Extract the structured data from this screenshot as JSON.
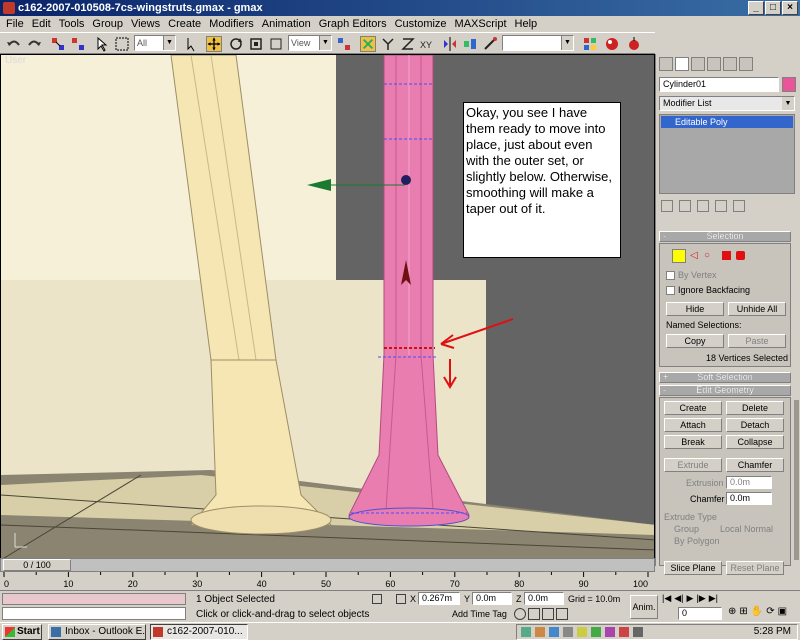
{
  "window": {
    "title": "c162-2007-010508-7cs-wingstruts.gmax - gmax"
  },
  "menu": [
    "File",
    "Edit",
    "Tools",
    "Group",
    "Views",
    "Create",
    "Modifiers",
    "Animation",
    "Graph Editors",
    "Customize",
    "MAXScript",
    "Help"
  ],
  "toolbar": {
    "selection_filter": "All",
    "reference_coord": "View",
    "named_selection": ""
  },
  "viewport": {
    "label": "User",
    "note": "Okay, you see I have them ready to move into place, just about even with the outer set, or slightly below. Otherwise, smoothing will make a taper out of it.",
    "colors": {
      "strut": "#f5e6b4",
      "pink_cylinder": "#e97db0",
      "background": "#646464",
      "arrow": "#e01010"
    }
  },
  "command_panel": {
    "object_name": "Cylinder01",
    "object_color": "#e8559a",
    "modifier_list": "Modifier List",
    "stack_item": "Editable Poly",
    "selection": {
      "title": "Selection",
      "by_vertex": "By Vertex",
      "ignore_backfacing": "Ignore Backfacing",
      "hide": "Hide",
      "unhide_all": "Unhide All",
      "named_selections": "Named Selections:",
      "copy": "Copy",
      "paste": "Paste",
      "status": "18 Vertices Selected"
    },
    "soft_selection": "Soft Selection",
    "edit_geometry": {
      "title": "Edit Geometry",
      "create": "Create",
      "delete": "Delete",
      "attach": "Attach",
      "detach": "Detach",
      "break": "Break",
      "collapse": "Collapse",
      "extrude": "Extrude",
      "chamfer": "Chamfer",
      "extrusion_label": "Extrusion",
      "extrusion_value": "0.0m",
      "chamfer_label": "Chamfer",
      "chamfer_value": "0.0m",
      "extrude_type": "Extrude Type",
      "group": "Group",
      "local_normal": "Local Normal",
      "by_polygon": "By Polygon",
      "slice_plane": "Slice Plane",
      "reset_plane": "Reset Plane"
    }
  },
  "timeline": {
    "slider": "0 / 100",
    "ticks": [
      "0",
      "10",
      "20",
      "30",
      "40",
      "50",
      "60",
      "70",
      "80",
      "90",
      "100"
    ]
  },
  "status": {
    "selected": "1 Object Selected",
    "prompt": "Click or click-and-drag to select objects",
    "x_label": "X",
    "x_value": "0.267m",
    "y_label": "Y",
    "y_value": "0.0m",
    "z_label": "Z",
    "z_value": "0.0m",
    "grid": "Grid = 10.0m",
    "add_time_tag": "Add Time Tag",
    "anim": "Anim.",
    "frame": "0"
  },
  "taskbar": {
    "start": "Start",
    "tasks": [
      "Inbox - Outlook E...",
      "c162-2007-010..."
    ],
    "clock": "5:28 PM"
  }
}
